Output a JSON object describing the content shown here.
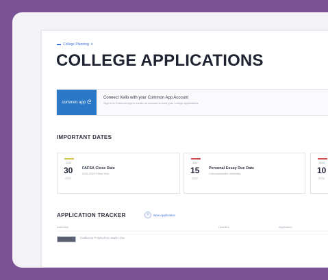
{
  "breadcrumb": {
    "label": "College Planning"
  },
  "page_title": "COLLEGE APPLICATIONS",
  "common_app": {
    "logo_text": "common app",
    "title": "Connect Xello with your Common App Account",
    "subtitle": "Sign in to Common App to create an account to track your college applications"
  },
  "important_dates": {
    "heading": "IMPORTANT DATES",
    "cards": [
      {
        "month": "JUN",
        "day": "30",
        "year": "2022",
        "name": "FAFSA Close Date",
        "desc": "2021-2022 Fafsa Year",
        "accent": "#d4c64a"
      },
      {
        "month": "JUL",
        "day": "15",
        "year": "2022",
        "name": "Personal Essay Due Date",
        "desc": "Commonwealth University",
        "accent": "#d24a4a"
      },
      {
        "month": "AUG",
        "day": "10",
        "year": "2022",
        "name": "",
        "desc": "",
        "accent": "#d24a4a"
      }
    ]
  },
  "tracker": {
    "heading": "APPLICATION TRACKER",
    "new_button": "New Application",
    "columns": [
      "Institution",
      "Deadline",
      "Application"
    ],
    "rows": [
      {
        "name": "California Polytechnic State Univ."
      }
    ]
  },
  "colors": {
    "background": "#7b5294",
    "accent": "#3c6fd8",
    "common_app_blue": "#2b78c6"
  }
}
